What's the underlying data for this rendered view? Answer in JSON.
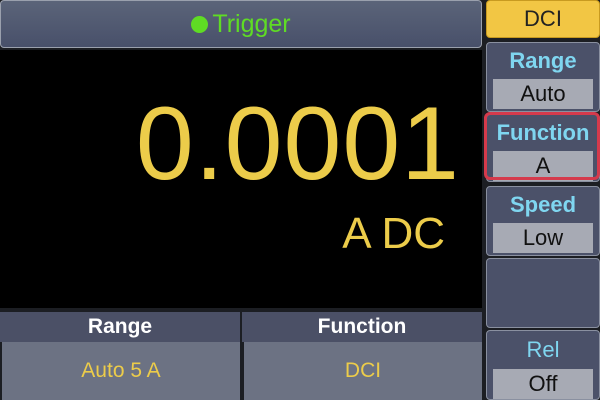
{
  "header": {
    "status_label": "Trigger",
    "status_color": "#5fdc24"
  },
  "reading": {
    "value": "0.0001",
    "unit": "A DC",
    "color": "#eccc4a"
  },
  "bottom": {
    "range": {
      "label": "Range",
      "value": "Auto 5 A"
    },
    "function": {
      "label": "Function",
      "value": "DCI"
    }
  },
  "softkeys": {
    "mode_tab": "DCI",
    "range": {
      "title": "Range",
      "value": "Auto"
    },
    "function": {
      "title": "Function",
      "value": "A",
      "selected": true
    },
    "speed": {
      "title": "Speed",
      "value": "Low"
    },
    "rel": {
      "title": "Rel",
      "value": "Off"
    }
  },
  "colors": {
    "accent": "#f2c644",
    "highlight": "#d53a4c",
    "softkey_title": "#7fd6f0"
  }
}
